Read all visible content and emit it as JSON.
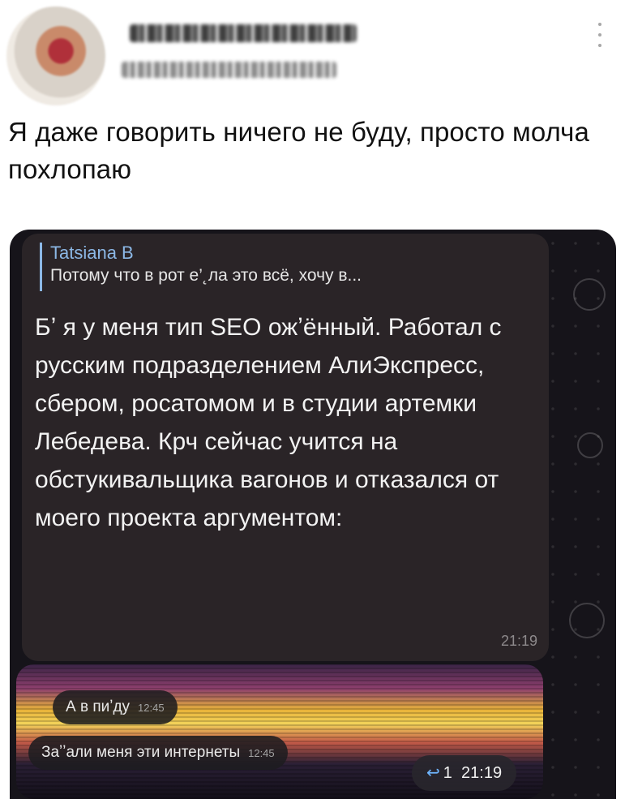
{
  "post": {
    "author_name": "",
    "author_handle": "",
    "text": "Я даже говорить ничего не буду, просто молча похлопаю"
  },
  "message": {
    "reply_name": "Tatsiana B",
    "reply_preview": "Потому что в рот е’˛ла это всё, хочу в...",
    "text": "Бʼ я у меня тип SEO ожʼённый. Работал с русским подразделением АлиЭкспресс, сбером, росатомом и в студии артемки Лебедева. Крч сейчас учится на обстукивальщика вагонов и отказался от моего проекта аргументом:",
    "time": "21:19"
  },
  "video_note": {
    "bubble1_text": "А в пиʼду",
    "bubble1_time": "12:45",
    "bubble2_text": "Заʼʼали меня эти интернеты",
    "bubble2_time": "12:45",
    "reaction_arrow": "↩",
    "reaction_count": "1",
    "reaction_time": "21:19"
  },
  "icons": [
    "avatar",
    "more-icon",
    "reply-arrow-icon"
  ]
}
